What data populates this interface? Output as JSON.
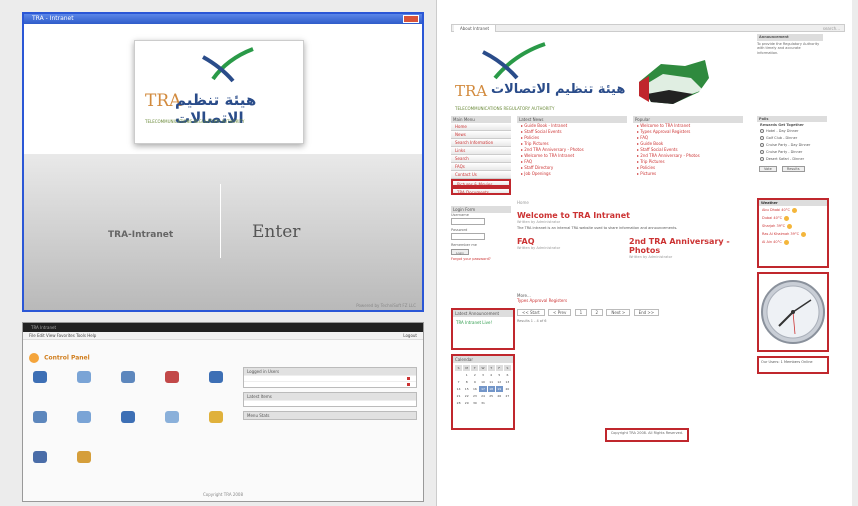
{
  "splash": {
    "window_title": "TRA - Intranet",
    "logo_text_latin": "TRA",
    "logo_text_arabic": "هيئة تنظيم الاتصالات",
    "logo_subtitle": "TELECOMMUNICATIONS REGULATORY AUTHORITY",
    "intranet_label": "TRA-Intranet",
    "enter_label": "Enter",
    "footer_text": "Powered by TechniSoft FZ LLC"
  },
  "app": {
    "dark_bar": "TRA Intranet",
    "menu": "File  Edit  View  Favorites  Tools  Help",
    "menu_right": "Logout",
    "panel_title": "Control Panel",
    "side_head_1": "Logged in Users",
    "side_head_2": "Latest Items",
    "side_head_3": "Menu Stats",
    "footer": "Copyright TRA 2008"
  },
  "intranet": {
    "tab_label": "About Intranet",
    "search_label": "search...",
    "announcement_head": "Announcement",
    "announcement_text": "To provide the Regulatory Authority with timely and accurate information.",
    "nav_head": "Main Menu",
    "nav_items": [
      "Home",
      "News",
      "Search Information",
      "Links",
      "Search",
      "FAQs",
      "Contact Us",
      "Pictures & Movies",
      "TRA Documents"
    ],
    "login_head": "Login Form",
    "login_username": "Username",
    "login_password": "Password",
    "login_remember": "Remember me",
    "login_button": "Login",
    "login_forgot": "Forgot your password?",
    "widget_head_1": "Latest Announcement",
    "widget_text_1": "TRA Intranet Live!",
    "widget_head_2": "Calendar",
    "calendar_header": [
      "S",
      "M",
      "T",
      "W",
      "T",
      "F",
      "S"
    ],
    "calendar_days": [
      "",
      "1",
      "2",
      "3",
      "4",
      "5",
      "6",
      "7",
      "8",
      "9",
      "10",
      "11",
      "12",
      "13",
      "14",
      "15",
      "16",
      "17",
      "18",
      "19",
      "20",
      "21",
      "22",
      "23",
      "24",
      "25",
      "26",
      "27",
      "28",
      "29",
      "30",
      "31",
      "",
      "",
      ""
    ],
    "list_head_1": "Latest News",
    "list_items_1": [
      "Guide Book - Intranet",
      "Staff Social Events",
      "Policies",
      "Trip Pictures",
      "2nd TRA Anniversary - Photos",
      "Welcome to TRA Intranet",
      "FAQ",
      "Staff Directory",
      "Job Openings"
    ],
    "list_head_2": "Popular",
    "list_items_2": [
      "Welcome to TRA Intranet",
      "Types Approval Registers",
      "FAQ",
      "Guide Book",
      "Staff Social Events",
      "2nd TRA Anniversary - Photos",
      "Trip Pictures",
      "Policies",
      "Pictures"
    ],
    "breadcrumb": "Home",
    "article_1_title": "Welcome to TRA Intranet",
    "article_1_meta": "Written by Administrator",
    "article_1_body": "The TRA intranet is an internal TRA website used to share information and announcements.",
    "article_2_title": "FAQ",
    "article_2_meta": "Written by Administrator",
    "article_3_title": "2nd TRA Anniversary - Photos",
    "article_3_meta": "Written by Administrator",
    "more_head": "More...",
    "more_link": "Types Approval Registers",
    "pager": [
      "<< Start",
      "< Prev",
      "1",
      "2",
      "Next >",
      "End >>"
    ],
    "results": "Results 1 - 4 of 6",
    "poll_head": "Polls",
    "poll_question": "Rewards Get Together",
    "poll_options": [
      "Hotel - Day Dinner",
      "Golf Club - Dinner",
      "Cruise Party - Day Dinner",
      "Cruise Party - Dinner",
      "Desert Safari - Dinner"
    ],
    "poll_vote": "Vote",
    "poll_results": "Results",
    "weather_head": "Weather",
    "weather_rows": [
      "Abu Dhabi 40°C",
      "Dubai 40°C",
      "Sharjah 39°C",
      "Ras Al Khaimah 39°C",
      "Al Ain 40°C"
    ],
    "clock_caption": "Our Users: 1 Members Online",
    "footer": "Copyright TRA 2008. All Rights Reserved."
  },
  "colors": {
    "highlight": "#c0272d",
    "link_red": "#cc3333",
    "splash_border": "#2b57d6"
  }
}
